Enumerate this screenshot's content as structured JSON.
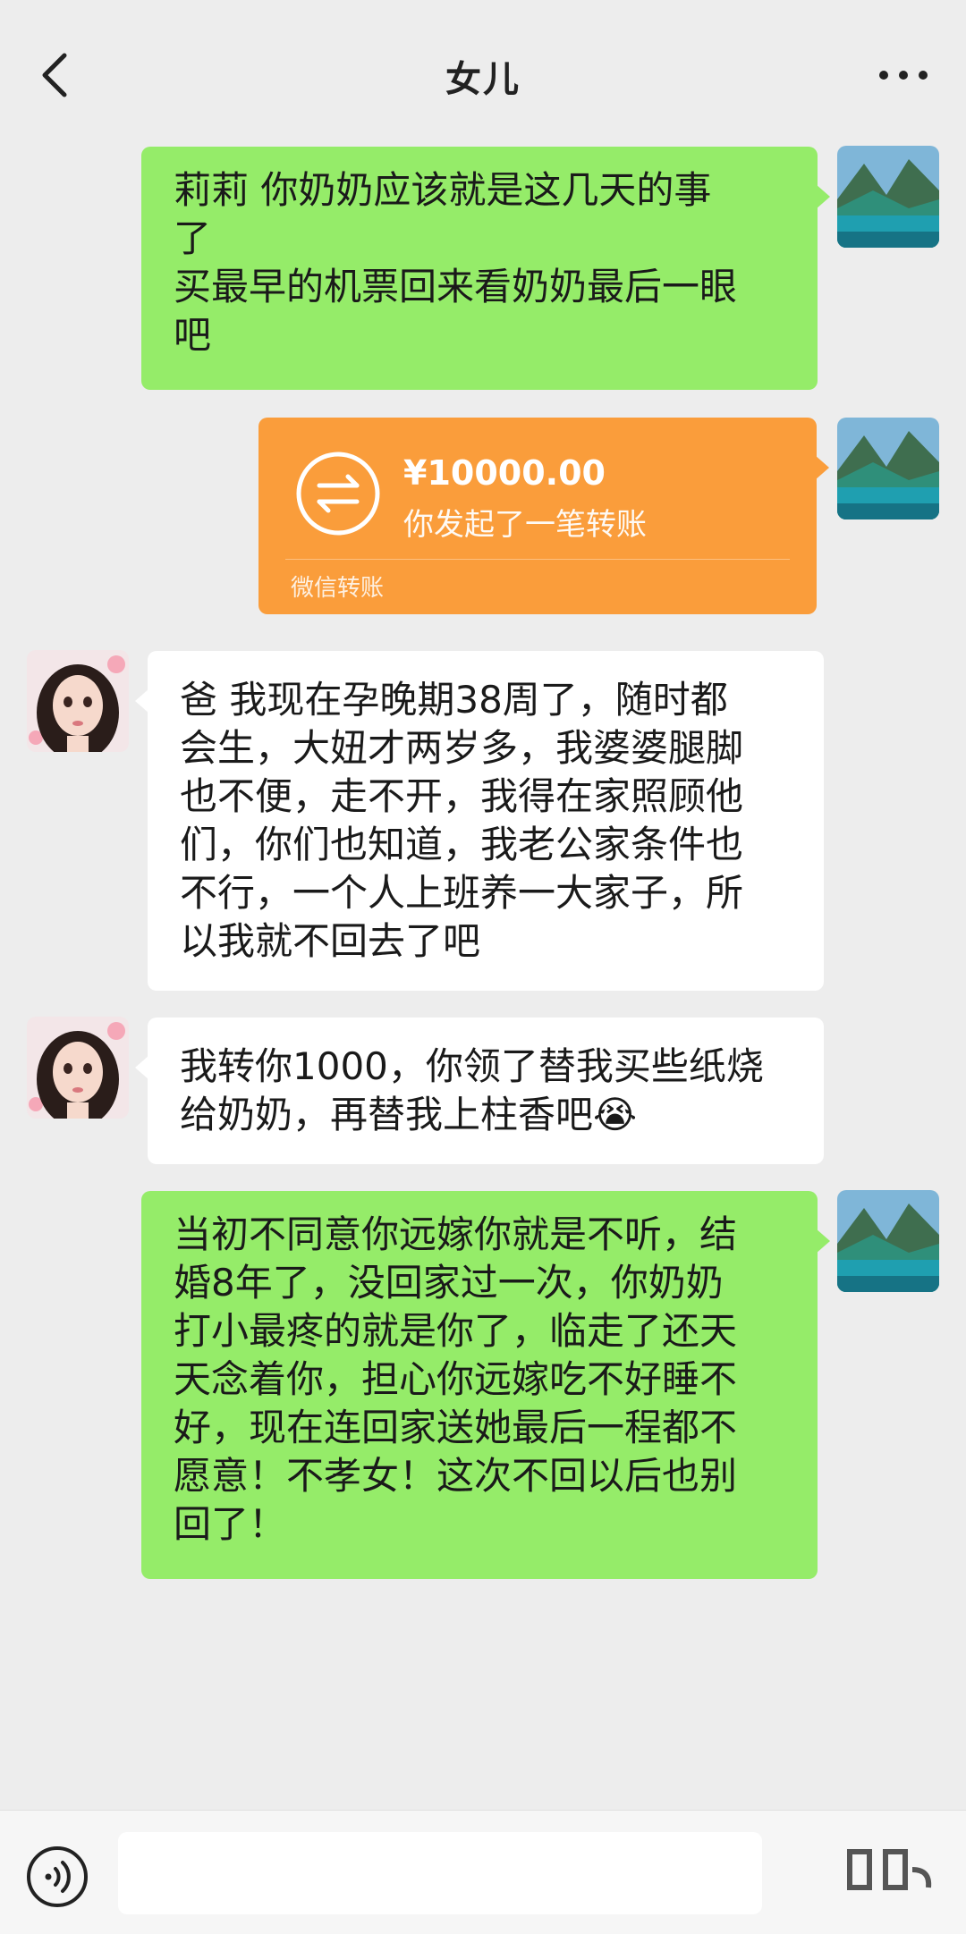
{
  "header": {
    "title": "女儿",
    "back_icon": "chevron-left-icon",
    "more_icon": "more-dots-icon"
  },
  "messages": [
    {
      "sender": "me",
      "type": "text",
      "lines": [
        "莉莉 你奶奶应该就是这几天的事",
        "了",
        "买最早的机票回来看奶奶最后一眼",
        "吧"
      ]
    },
    {
      "sender": "me",
      "type": "transfer",
      "amount": "¥10000.00",
      "description": "你发起了一笔转账",
      "footer": "微信转账"
    },
    {
      "sender": "daughter",
      "type": "text",
      "lines": [
        "爸 我现在孕晚期38周了，随时都",
        "会生，大妞才两岁多，我婆婆腿脚",
        "也不便，走不开，我得在家照顾他",
        "们，你们也知道，我老公家条件也",
        "不行，一个人上班养一大家子，所",
        "以我就不回去了吧"
      ]
    },
    {
      "sender": "daughter",
      "type": "text",
      "lines": [
        "我转你1000，你领了替我买些纸烧",
        "给奶奶，再替我上柱香吧😭"
      ]
    },
    {
      "sender": "me",
      "type": "text",
      "lines": [
        "当初不同意你远嫁你就是不听，结",
        "婚8年了，没回家过一次，你奶奶",
        "打小最疼的就是你了，临走了还天",
        "天念着你，担心你远嫁吃不好睡不",
        "好，现在连回家送她最后一程都不",
        "愿意！不孝女！这次不回以后也别",
        "回了！"
      ]
    }
  ],
  "input_bar": {
    "voice_icon": "voice-icon",
    "value": ""
  },
  "colors": {
    "background": "#ededed",
    "my_bubble": "#95ec69",
    "their_bubble": "#ffffff",
    "transfer": "#fa9d3b"
  }
}
